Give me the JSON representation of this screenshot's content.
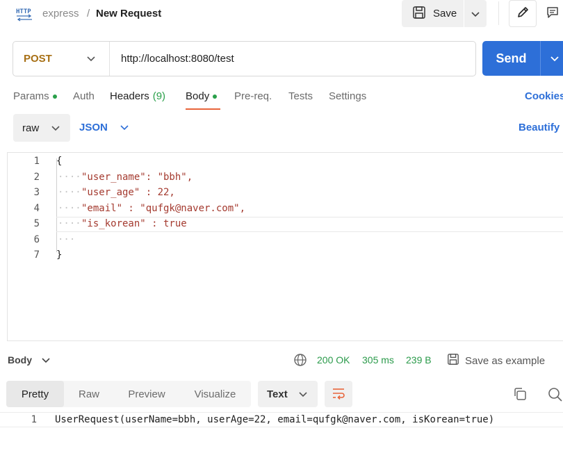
{
  "header": {
    "app_icon": "http-icon",
    "breadcrumb": {
      "collection": "express",
      "separator": "/",
      "title": "New Request"
    },
    "save_label": "Save"
  },
  "request": {
    "method": "POST",
    "url": "http://localhost:8080/test",
    "send_label": "Send"
  },
  "tabs": {
    "params": "Params",
    "auth": "Auth",
    "headers": "Headers",
    "headers_count": "(9)",
    "body": "Body",
    "prereq": "Pre-req.",
    "tests": "Tests",
    "settings": "Settings",
    "cookies": "Cookies",
    "active": "Body"
  },
  "body_mode": {
    "mode": "raw",
    "format": "JSON",
    "beautify": "Beautify"
  },
  "editor": {
    "line_numbers": [
      "1",
      "2",
      "3",
      "4",
      "5",
      "6",
      "7"
    ],
    "lines": [
      "{",
      "\"user_name\": \"bbh\",",
      "\"user_age\" : 22,",
      "\"email\" : \"qufgk@naver.com\",",
      "\"is_korean\" : true",
      "",
      "}"
    ]
  },
  "response": {
    "section_label": "Body",
    "status": "200 OK",
    "time": "305 ms",
    "size": "239 B",
    "save_example": "Save as example",
    "view_tabs": [
      "Pretty",
      "Raw",
      "Preview",
      "Visualize"
    ],
    "active_view": "Pretty",
    "format": "Text",
    "line_number": "1",
    "content": "UserRequest(userName=bbh, userAge=22, email=qufgk@naver.com, isKorean=true)"
  },
  "colors": {
    "accent_blue": "#2d6fd8",
    "method_post": "#a76f14",
    "success_green": "#2a9a4a",
    "active_tab_underline": "#e8643a"
  }
}
